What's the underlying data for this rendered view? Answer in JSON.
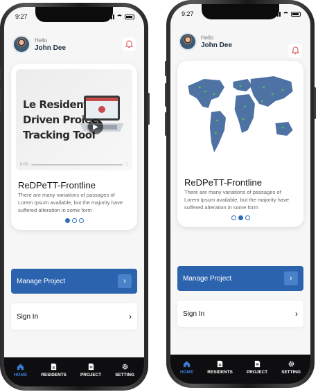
{
  "theme": {
    "accent": "#2c63ae",
    "nav_bg": "#0e0e10",
    "active": "#3a7bd5"
  },
  "phones": [
    {
      "status": {
        "time": "9:27"
      },
      "header": {
        "greeting": "Hello",
        "name": "John Dee",
        "notification_icon": "bell-icon"
      },
      "carousel": {
        "media": "video",
        "hero_text": [
          "Le Resident-",
          "Driven Project",
          "Tracking Tool"
        ],
        "video_time": "0:00",
        "title": "ReDPeTT-Frontline",
        "description": "There are many variations of passages of Lorem Ipsum available, but the majority have suffered alteration in some form",
        "active_slide": 1,
        "slides": 3
      },
      "buttons": {
        "manage": "Manage Project",
        "signin": "Sign In"
      },
      "nav": [
        {
          "label": "HOME",
          "icon": "home-icon",
          "active": true
        },
        {
          "label": "RESIDENTS",
          "icon": "document-icon",
          "active": false
        },
        {
          "label": "PROJECT",
          "icon": "file-icon",
          "active": false
        },
        {
          "label": "SETTING",
          "icon": "gear-icon",
          "active": false
        }
      ]
    },
    {
      "status": {
        "time": "9:27"
      },
      "header": {
        "greeting": "Hello",
        "name": "John Dee",
        "notification_icon": "bell-icon"
      },
      "carousel": {
        "media": "world-map",
        "title": "ReDPeTT-Frontline",
        "description": "There are many variations of passages of Lorem Ipsum available, but the majority have suffered alteration in some form",
        "active_slide": 2,
        "slides": 3
      },
      "buttons": {
        "manage": "Manage Project",
        "signin": "Sign In"
      },
      "nav": [
        {
          "label": "HOME",
          "icon": "home-icon",
          "active": true
        },
        {
          "label": "RESIDENTS",
          "icon": "document-icon",
          "active": false
        },
        {
          "label": "PROJECT",
          "icon": "file-icon",
          "active": false
        },
        {
          "label": "SETTING",
          "icon": "gear-icon",
          "active": false
        }
      ]
    }
  ]
}
